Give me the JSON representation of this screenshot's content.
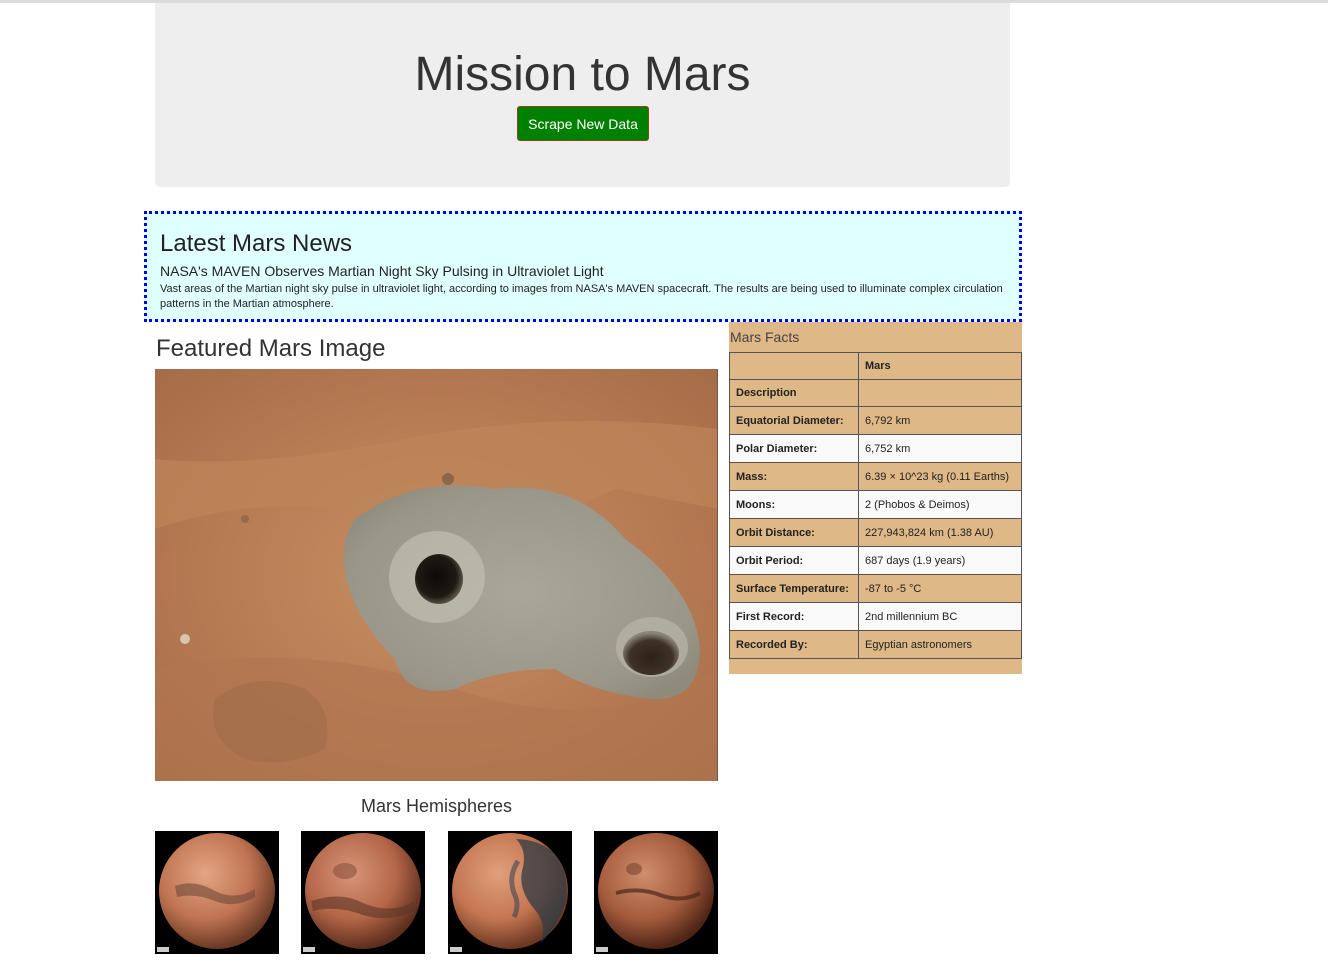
{
  "header": {
    "title": "Mission to Mars",
    "scrape_button_label": "Scrape New Data"
  },
  "news": {
    "heading": "Latest Mars News",
    "title": "NASA's MAVEN Observes Martian Night Sky Pulsing in Ultraviolet Light",
    "teaser": "Vast areas of the Martian night sky pulse in ultraviolet light, according to images from NASA's MAVEN spacecraft. The results are being used to illuminate complex circulation patterns in the Martian atmosphere."
  },
  "featured": {
    "heading": "Featured Mars Image"
  },
  "facts": {
    "caption": "Mars Facts",
    "column_header": "Mars",
    "index_header": "Description",
    "rows": [
      {
        "label": "Equatorial Diameter:",
        "value": "6,792 km"
      },
      {
        "label": "Polar Diameter:",
        "value": "6,752 km"
      },
      {
        "label": "Mass:",
        "value": "6.39 × 10^23 kg (0.11 Earths)"
      },
      {
        "label": "Moons:",
        "value": "2 (Phobos & Deimos)"
      },
      {
        "label": "Orbit Distance:",
        "value": "227,943,824 km (1.38 AU)"
      },
      {
        "label": "Orbit Period:",
        "value": "687 days (1.9 years)"
      },
      {
        "label": "Surface Temperature:",
        "value": "-87 to -5 °C"
      },
      {
        "label": "First Record:",
        "value": "2nd millennium BC"
      },
      {
        "label": "Recorded By:",
        "value": "Egyptian astronomers"
      }
    ]
  },
  "hemispheres": {
    "heading": "Mars Hemispheres",
    "count": 4
  },
  "colors": {
    "jumbotron_bg": "#eeeeee",
    "scrape_button": "#008000",
    "news_bg": "#e0ffff",
    "news_border": "#0000ee",
    "facts_bg": "#deb887"
  }
}
